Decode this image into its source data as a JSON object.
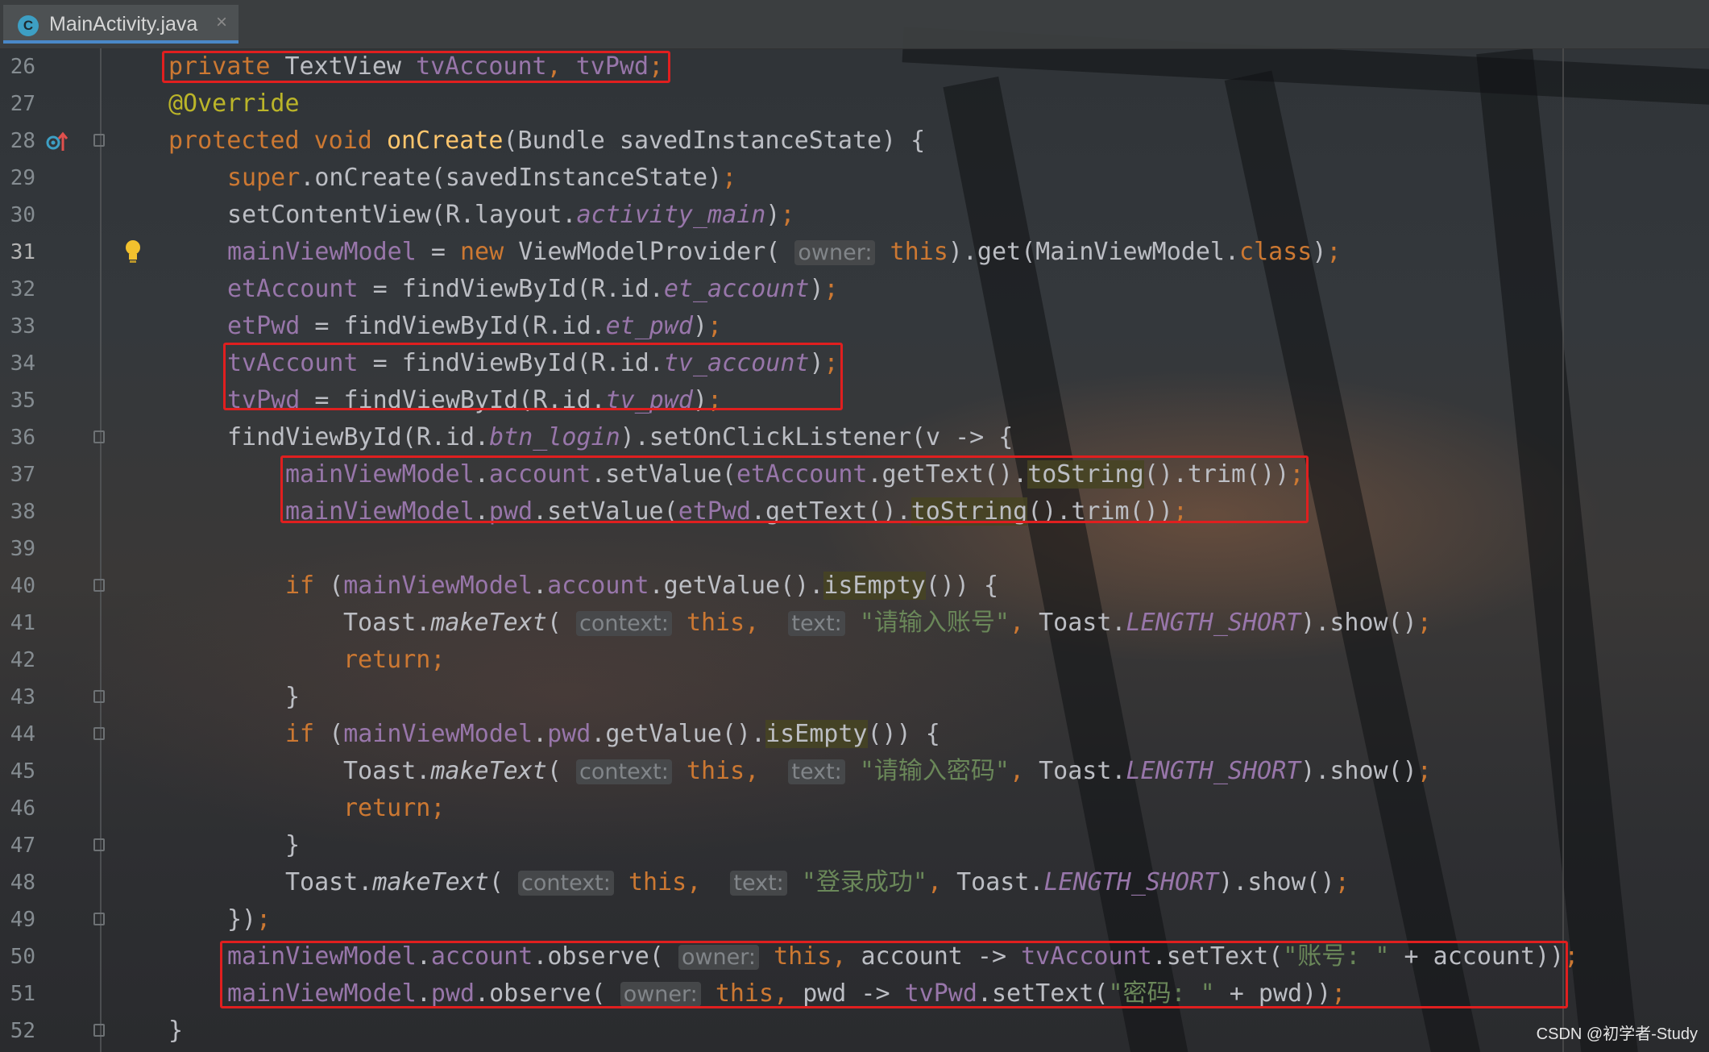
{
  "tab": {
    "icon_letter": "C",
    "title": "MainActivity.java",
    "close": "×"
  },
  "lines": [
    {
      "num": "26",
      "tokens": [
        {
          "t": "private ",
          "c": "kw"
        },
        {
          "t": "TextView "
        },
        {
          "t": "tvAccount",
          "c": "fld"
        },
        {
          "t": ", ",
          "c": "kw"
        },
        {
          "t": "tvPwd",
          "c": "fld"
        },
        {
          "t": ";",
          "c": "kw"
        }
      ]
    },
    {
      "num": "27",
      "tokens": [
        {
          "t": "@Override",
          "c": "ann"
        }
      ]
    },
    {
      "num": "28",
      "tokens": [
        {
          "t": "protected ",
          "c": "kw"
        },
        {
          "t": "void ",
          "c": "kw"
        },
        {
          "t": "onCreate",
          "c": "mth"
        },
        {
          "t": "(Bundle savedInstanceState) {"
        }
      ]
    },
    {
      "num": "29",
      "tokens": [
        {
          "t": "super",
          "c": "kw"
        },
        {
          "t": ".onCreate(savedInstanceState)"
        },
        {
          "t": ";",
          "c": "kw"
        }
      ]
    },
    {
      "num": "30",
      "tokens": [
        {
          "t": "setContentView(R.layout."
        },
        {
          "t": "activity_main",
          "c": "ifld"
        },
        {
          "t": ")"
        },
        {
          "t": ";",
          "c": "kw"
        }
      ]
    },
    {
      "num": "31",
      "tokens": [
        {
          "t": "mainViewModel",
          "c": "fld"
        },
        {
          "t": " = "
        },
        {
          "t": "new ",
          "c": "kw"
        },
        {
          "t": "ViewModelProvider( "
        },
        {
          "t": "owner:",
          "c": "hint"
        },
        {
          "t": " "
        },
        {
          "t": "this",
          "c": "kw"
        },
        {
          "t": ").get(MainViewModel."
        },
        {
          "t": "class",
          "c": "kw"
        },
        {
          "t": ")"
        },
        {
          "t": ";",
          "c": "kw"
        }
      ]
    },
    {
      "num": "32",
      "tokens": [
        {
          "t": "etAccount",
          "c": "fld"
        },
        {
          "t": " = findViewById(R.id."
        },
        {
          "t": "et_account",
          "c": "ifld"
        },
        {
          "t": ")"
        },
        {
          "t": ";",
          "c": "kw"
        }
      ]
    },
    {
      "num": "33",
      "tokens": [
        {
          "t": "etPwd",
          "c": "fld"
        },
        {
          "t": " = findViewById(R.id."
        },
        {
          "t": "et_pwd",
          "c": "ifld"
        },
        {
          "t": ")"
        },
        {
          "t": ";",
          "c": "kw"
        }
      ]
    },
    {
      "num": "34",
      "tokens": [
        {
          "t": "tvAccount",
          "c": "fld"
        },
        {
          "t": " = findViewById(R.id."
        },
        {
          "t": "tv_account",
          "c": "ifld"
        },
        {
          "t": ")"
        },
        {
          "t": ";",
          "c": "kw"
        }
      ]
    },
    {
      "num": "35",
      "tokens": [
        {
          "t": "tvPwd",
          "c": "fld"
        },
        {
          "t": " = findViewById(R.id."
        },
        {
          "t": "tv_pwd",
          "c": "ifld"
        },
        {
          "t": ")"
        },
        {
          "t": ";",
          "c": "kw"
        }
      ]
    },
    {
      "num": "36",
      "tokens": [
        {
          "t": "findViewById(R.id."
        },
        {
          "t": "btn_login",
          "c": "ifld"
        },
        {
          "t": ").setOnClickListener(v -> {"
        }
      ]
    },
    {
      "num": "37",
      "tokens": [
        {
          "t": "mainViewModel",
          "c": "fld"
        },
        {
          "t": "."
        },
        {
          "t": "account",
          "c": "fld"
        },
        {
          "t": ".setValue("
        },
        {
          "t": "etAccount",
          "c": "fld"
        },
        {
          "t": ".getText()."
        },
        {
          "t": "toString",
          "c": "hl"
        },
        {
          "t": "().trim())"
        },
        {
          "t": ";",
          "c": "kw"
        }
      ]
    },
    {
      "num": "38",
      "tokens": [
        {
          "t": "mainViewModel",
          "c": "fld"
        },
        {
          "t": "."
        },
        {
          "t": "pwd",
          "c": "fld"
        },
        {
          "t": ".setValue("
        },
        {
          "t": "etPwd",
          "c": "fld"
        },
        {
          "t": ".getText()."
        },
        {
          "t": "toString",
          "c": "hl"
        },
        {
          "t": "().trim())"
        },
        {
          "t": ";",
          "c": "kw"
        }
      ]
    },
    {
      "num": "39",
      "tokens": []
    },
    {
      "num": "40",
      "tokens": [
        {
          "t": "if ",
          "c": "kw"
        },
        {
          "t": "("
        },
        {
          "t": "mainViewModel",
          "c": "fld"
        },
        {
          "t": "."
        },
        {
          "t": "account",
          "c": "fld"
        },
        {
          "t": ".getValue()."
        },
        {
          "t": "isEmpty",
          "c": "hl"
        },
        {
          "t": "()) {"
        }
      ]
    },
    {
      "num": "41",
      "tokens": [
        {
          "t": "Toast."
        },
        {
          "t": "makeText",
          "c": "it"
        },
        {
          "t": "( "
        },
        {
          "t": "context:",
          "c": "hint"
        },
        {
          "t": " "
        },
        {
          "t": "this",
          "c": "kw"
        },
        {
          "t": ",  ",
          "c": "kw"
        },
        {
          "t": "text:",
          "c": "hint"
        },
        {
          "t": " "
        },
        {
          "t": "\"请输入账号\"",
          "c": "str"
        },
        {
          "t": ", ",
          "c": "kw"
        },
        {
          "t": "Toast."
        },
        {
          "t": "LENGTH_SHORT",
          "c": "ifld"
        },
        {
          "t": ").show()"
        },
        {
          "t": ";",
          "c": "kw"
        }
      ]
    },
    {
      "num": "42",
      "tokens": [
        {
          "t": "return",
          "c": "kw"
        },
        {
          "t": ";",
          "c": "kw"
        }
      ]
    },
    {
      "num": "43",
      "tokens": [
        {
          "t": "}"
        }
      ]
    },
    {
      "num": "44",
      "tokens": [
        {
          "t": "if ",
          "c": "kw"
        },
        {
          "t": "("
        },
        {
          "t": "mainViewModel",
          "c": "fld"
        },
        {
          "t": "."
        },
        {
          "t": "pwd",
          "c": "fld"
        },
        {
          "t": ".getValue()."
        },
        {
          "t": "isEmpty",
          "c": "hl"
        },
        {
          "t": "()) {"
        }
      ]
    },
    {
      "num": "45",
      "tokens": [
        {
          "t": "Toast."
        },
        {
          "t": "makeText",
          "c": "it"
        },
        {
          "t": "( "
        },
        {
          "t": "context:",
          "c": "hint"
        },
        {
          "t": " "
        },
        {
          "t": "this",
          "c": "kw"
        },
        {
          "t": ",  ",
          "c": "kw"
        },
        {
          "t": "text:",
          "c": "hint"
        },
        {
          "t": " "
        },
        {
          "t": "\"请输入密码\"",
          "c": "str"
        },
        {
          "t": ", ",
          "c": "kw"
        },
        {
          "t": "Toast."
        },
        {
          "t": "LENGTH_SHORT",
          "c": "ifld"
        },
        {
          "t": ").show()"
        },
        {
          "t": ";",
          "c": "kw"
        }
      ]
    },
    {
      "num": "46",
      "tokens": [
        {
          "t": "return",
          "c": "kw"
        },
        {
          "t": ";",
          "c": "kw"
        }
      ]
    },
    {
      "num": "47",
      "tokens": [
        {
          "t": "}"
        }
      ]
    },
    {
      "num": "48",
      "tokens": [
        {
          "t": "Toast."
        },
        {
          "t": "makeText",
          "c": "it"
        },
        {
          "t": "( "
        },
        {
          "t": "context:",
          "c": "hint"
        },
        {
          "t": " "
        },
        {
          "t": "this",
          "c": "kw"
        },
        {
          "t": ",  ",
          "c": "kw"
        },
        {
          "t": "text:",
          "c": "hint"
        },
        {
          "t": " "
        },
        {
          "t": "\"登录成功\"",
          "c": "str"
        },
        {
          "t": ", ",
          "c": "kw"
        },
        {
          "t": "Toast."
        },
        {
          "t": "LENGTH_SHORT",
          "c": "ifld"
        },
        {
          "t": ").show()"
        },
        {
          "t": ";",
          "c": "kw"
        }
      ]
    },
    {
      "num": "49",
      "tokens": [
        {
          "t": "})"
        },
        {
          "t": ";",
          "c": "kw"
        }
      ]
    },
    {
      "num": "50",
      "tokens": [
        {
          "t": "mainViewModel",
          "c": "fld"
        },
        {
          "t": "."
        },
        {
          "t": "account",
          "c": "fld"
        },
        {
          "t": ".observe( "
        },
        {
          "t": "owner:",
          "c": "hint"
        },
        {
          "t": " "
        },
        {
          "t": "this",
          "c": "kw"
        },
        {
          "t": ", ",
          "c": "kw"
        },
        {
          "t": "account -> "
        },
        {
          "t": "tvAccount",
          "c": "fld"
        },
        {
          "t": ".setText("
        },
        {
          "t": "\"账号: \"",
          "c": "str"
        },
        {
          "t": " + account))"
        },
        {
          "t": ";",
          "c": "kw"
        }
      ]
    },
    {
      "num": "51",
      "tokens": [
        {
          "t": "mainViewModel",
          "c": "fld"
        },
        {
          "t": "."
        },
        {
          "t": "pwd",
          "c": "fld"
        },
        {
          "t": ".observe( "
        },
        {
          "t": "owner:",
          "c": "hint"
        },
        {
          "t": " "
        },
        {
          "t": "this",
          "c": "kw"
        },
        {
          "t": ", ",
          "c": "kw"
        },
        {
          "t": "pwd -> "
        },
        {
          "t": "tvPwd",
          "c": "fld"
        },
        {
          "t": ".setText("
        },
        {
          "t": "\"密码: \"",
          "c": "str"
        },
        {
          "t": " + pwd))"
        },
        {
          "t": ";",
          "c": "kw"
        }
      ]
    },
    {
      "num": "52",
      "tokens": [
        {
          "t": "}"
        }
      ]
    }
  ],
  "current_line": "31",
  "watermark": "CSDN @初学者-Study",
  "colors": {
    "keyword": "#cc7832",
    "field": "#9876aa",
    "string": "#6a8759",
    "method": "#ffc66d",
    "annotation": "#bbb529",
    "default": "#bcbec4",
    "highlight_box": "#e01f1f",
    "tab_underline": "#4a88c7"
  }
}
